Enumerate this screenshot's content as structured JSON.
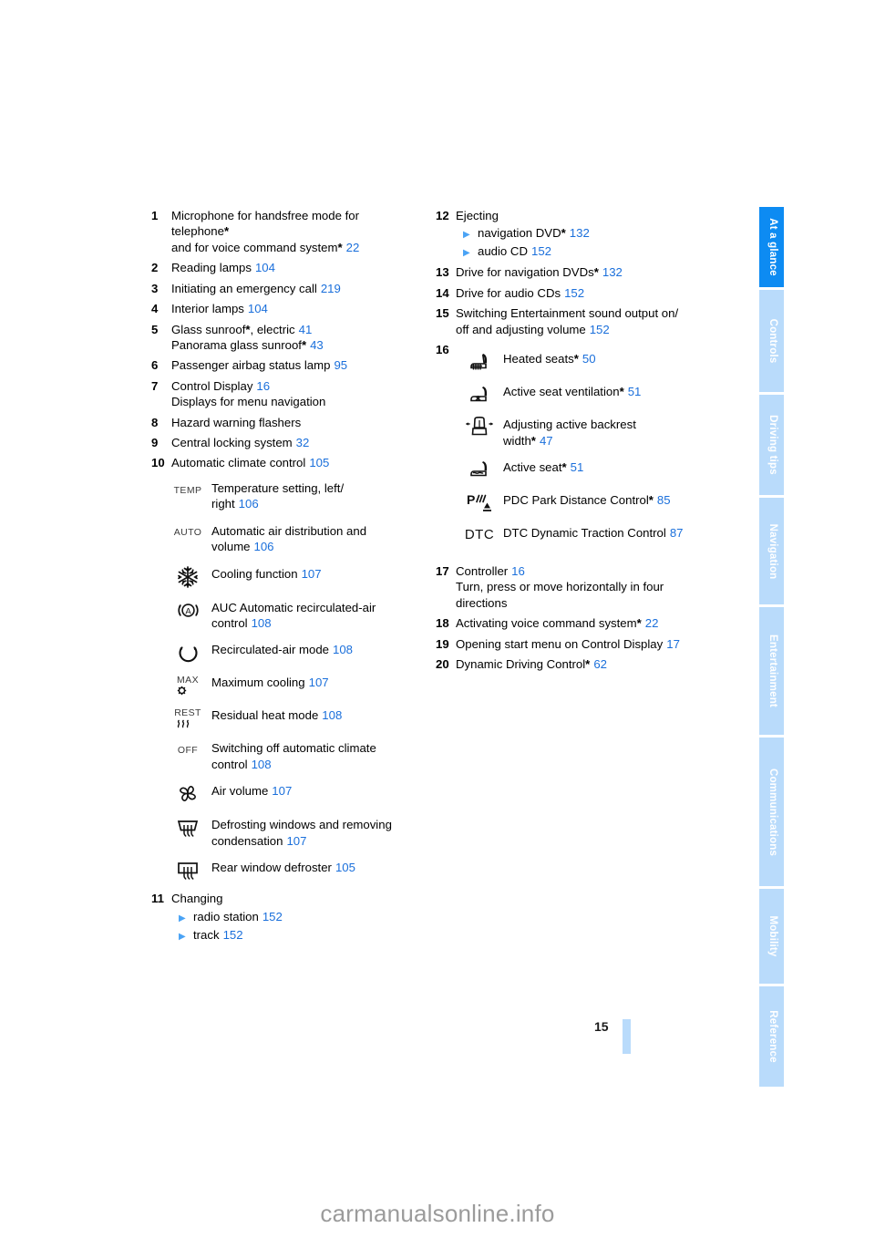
{
  "page": {
    "number": "15",
    "watermark": "carmanualsonline.info"
  },
  "colors": {
    "accent_active_tab": "#0d8bf2",
    "accent_inactive_tab": "#b9dbfb",
    "reference_link": "#1a6fdb",
    "bullet_triangle": "#4aa3f5",
    "text": "#000000"
  },
  "tabs": [
    {
      "label": "At a glance",
      "active": true
    },
    {
      "label": "Controls",
      "active": false
    },
    {
      "label": "Driving tips",
      "active": false
    },
    {
      "label": "Navigation",
      "active": false
    },
    {
      "label": "Entertainment",
      "active": false
    },
    {
      "label": "Communications",
      "active": false
    },
    {
      "label": "Mobility",
      "active": false
    },
    {
      "label": "Reference",
      "active": false
    }
  ],
  "left_column": {
    "items": [
      {
        "num": "1",
        "lines": [
          {
            "text": "Microphone for handsfree mode for",
            "star": false,
            "ref": ""
          },
          {
            "text": "telephone",
            "star": true,
            "ref": ""
          },
          {
            "text": "and for voice command system",
            "star": true,
            "ref": "22"
          }
        ]
      },
      {
        "num": "2",
        "lines": [
          {
            "text": "Reading lamps",
            "star": false,
            "ref": "104"
          }
        ]
      },
      {
        "num": "3",
        "lines": [
          {
            "text": "Initiating an emergency call",
            "star": false,
            "ref": "219"
          }
        ]
      },
      {
        "num": "4",
        "lines": [
          {
            "text": "Interior lamps",
            "star": false,
            "ref": "104"
          }
        ]
      },
      {
        "num": "5",
        "lines": [
          {
            "text": "Glass sunroof",
            "star": true,
            "after_star": ", electric",
            "ref": "41"
          },
          {
            "text": "Panorama glass sunroof",
            "star": true,
            "ref": "43"
          }
        ]
      },
      {
        "num": "6",
        "lines": [
          {
            "text": "Passenger airbag status lamp",
            "star": false,
            "ref": "95"
          }
        ]
      },
      {
        "num": "7",
        "lines": [
          {
            "text": "Control Display",
            "star": false,
            "ref": "16"
          },
          {
            "text": "Displays for menu navigation",
            "star": false,
            "ref": ""
          }
        ]
      },
      {
        "num": "8",
        "lines": [
          {
            "text": "Hazard warning flashers",
            "star": false,
            "ref": ""
          }
        ]
      },
      {
        "num": "9",
        "lines": [
          {
            "text": "Central locking system",
            "star": false,
            "ref": "32"
          }
        ]
      },
      {
        "num": "10",
        "lines": [
          {
            "text": "Automatic climate control",
            "star": false,
            "ref": "105"
          }
        ]
      }
    ],
    "climate_icons": [
      {
        "icon": "temp-text-icon",
        "glyph": "TEMP",
        "lines": [
          {
            "text": "Temperature setting, left/",
            "ref": ""
          },
          {
            "text": "right",
            "ref": "106"
          }
        ]
      },
      {
        "icon": "auto-text-icon",
        "glyph": "AUTO",
        "lines": [
          {
            "text": "Automatic air distribution and",
            "ref": ""
          },
          {
            "text": "volume",
            "ref": "106"
          }
        ]
      },
      {
        "icon": "snowflake-icon",
        "glyph": "",
        "lines": [
          {
            "text": "Cooling function",
            "ref": "107"
          }
        ]
      },
      {
        "icon": "auc-recirculation-icon",
        "glyph": "",
        "lines": [
          {
            "text": "AUC Automatic recirculated-air",
            "ref": ""
          },
          {
            "text": "control",
            "ref": "108"
          }
        ]
      },
      {
        "icon": "recirculated-air-icon",
        "glyph": "",
        "lines": [
          {
            "text": "Recirculated-air mode",
            "ref": "108"
          }
        ]
      },
      {
        "icon": "max-cooling-icon",
        "glyph": "MAX",
        "lines": [
          {
            "text": "Maximum cooling",
            "ref": "107"
          }
        ]
      },
      {
        "icon": "residual-heat-icon",
        "glyph": "REST",
        "lines": [
          {
            "text": "Residual heat mode",
            "ref": "108"
          }
        ]
      },
      {
        "icon": "off-text-icon",
        "glyph": "OFF",
        "lines": [
          {
            "text": "Switching off automatic climate",
            "ref": ""
          },
          {
            "text": "control",
            "ref": "108"
          }
        ]
      },
      {
        "icon": "fan-icon",
        "glyph": "",
        "lines": [
          {
            "text": "Air volume",
            "ref": "107"
          }
        ]
      },
      {
        "icon": "windshield-defrost-icon",
        "glyph": "",
        "lines": [
          {
            "text": "Defrosting windows and removing",
            "ref": ""
          },
          {
            "text": "condensation",
            "ref": "107"
          }
        ]
      },
      {
        "icon": "rear-window-defroster-icon",
        "glyph": "",
        "lines": [
          {
            "text": "Rear window defroster",
            "ref": "105"
          }
        ]
      }
    ],
    "item_11": {
      "num": "11",
      "title": "Changing",
      "subs": [
        {
          "text": "radio station",
          "ref": "152"
        },
        {
          "text": "track",
          "ref": "152"
        }
      ]
    }
  },
  "right_column": {
    "item_12": {
      "num": "12",
      "title": "Ejecting",
      "subs": [
        {
          "text": "navigation DVD",
          "star": true,
          "ref": "132"
        },
        {
          "text": "audio CD",
          "star": false,
          "ref": "152"
        }
      ]
    },
    "items": [
      {
        "num": "13",
        "lines": [
          {
            "text": "Drive for navigation DVDs",
            "star": true,
            "ref": "132"
          }
        ]
      },
      {
        "num": "14",
        "lines": [
          {
            "text": "Drive for audio CDs",
            "star": false,
            "ref": "152"
          }
        ]
      },
      {
        "num": "15",
        "lines": [
          {
            "text": "Switching Entertainment sound output on/",
            "star": false,
            "ref": ""
          },
          {
            "text": "off and adjusting volume",
            "star": false,
            "ref": "152"
          }
        ]
      }
    ],
    "item_16": {
      "num": "16",
      "icons": [
        {
          "icon": "heated-seat-icon",
          "glyph": "",
          "lines": [
            {
              "text": "Heated seats",
              "star": true,
              "ref": "50"
            }
          ]
        },
        {
          "icon": "seat-ventilation-icon",
          "glyph": "",
          "lines": [
            {
              "text": "Active seat ventilation",
              "star": true,
              "ref": "51"
            }
          ]
        },
        {
          "icon": "backrest-width-icon",
          "glyph": "",
          "lines": [
            {
              "text": "Adjusting active backrest",
              "star": false,
              "ref": ""
            },
            {
              "text": "width",
              "star": true,
              "ref": "47"
            }
          ]
        },
        {
          "icon": "active-seat-icon",
          "glyph": "",
          "lines": [
            {
              "text": "Active seat",
              "star": true,
              "ref": "51"
            }
          ]
        },
        {
          "icon": "pdc-icon",
          "glyph": "",
          "lines": [
            {
              "text": "PDC Park Distance Control",
              "star": true,
              "ref": "85"
            }
          ]
        },
        {
          "icon": "dtc-icon",
          "glyph": "DTC",
          "lines": [
            {
              "text": "DTC Dynamic Traction Control",
              "star": false,
              "ref": "87"
            }
          ]
        }
      ]
    },
    "items_tail": [
      {
        "num": "17",
        "lines": [
          {
            "text": "Controller",
            "star": false,
            "ref": "16"
          },
          {
            "text": "Turn, press or move horizontally in four",
            "star": false,
            "ref": ""
          },
          {
            "text": "directions",
            "star": false,
            "ref": ""
          }
        ]
      },
      {
        "num": "18",
        "lines": [
          {
            "text": "Activating voice command system",
            "star": true,
            "ref": "22"
          }
        ]
      },
      {
        "num": "19",
        "lines": [
          {
            "text": "Opening start menu on Control Display",
            "star": false,
            "ref": "17"
          }
        ]
      },
      {
        "num": "20",
        "lines": [
          {
            "text": "Dynamic Driving Control",
            "star": true,
            "ref": "62"
          }
        ]
      }
    ]
  }
}
